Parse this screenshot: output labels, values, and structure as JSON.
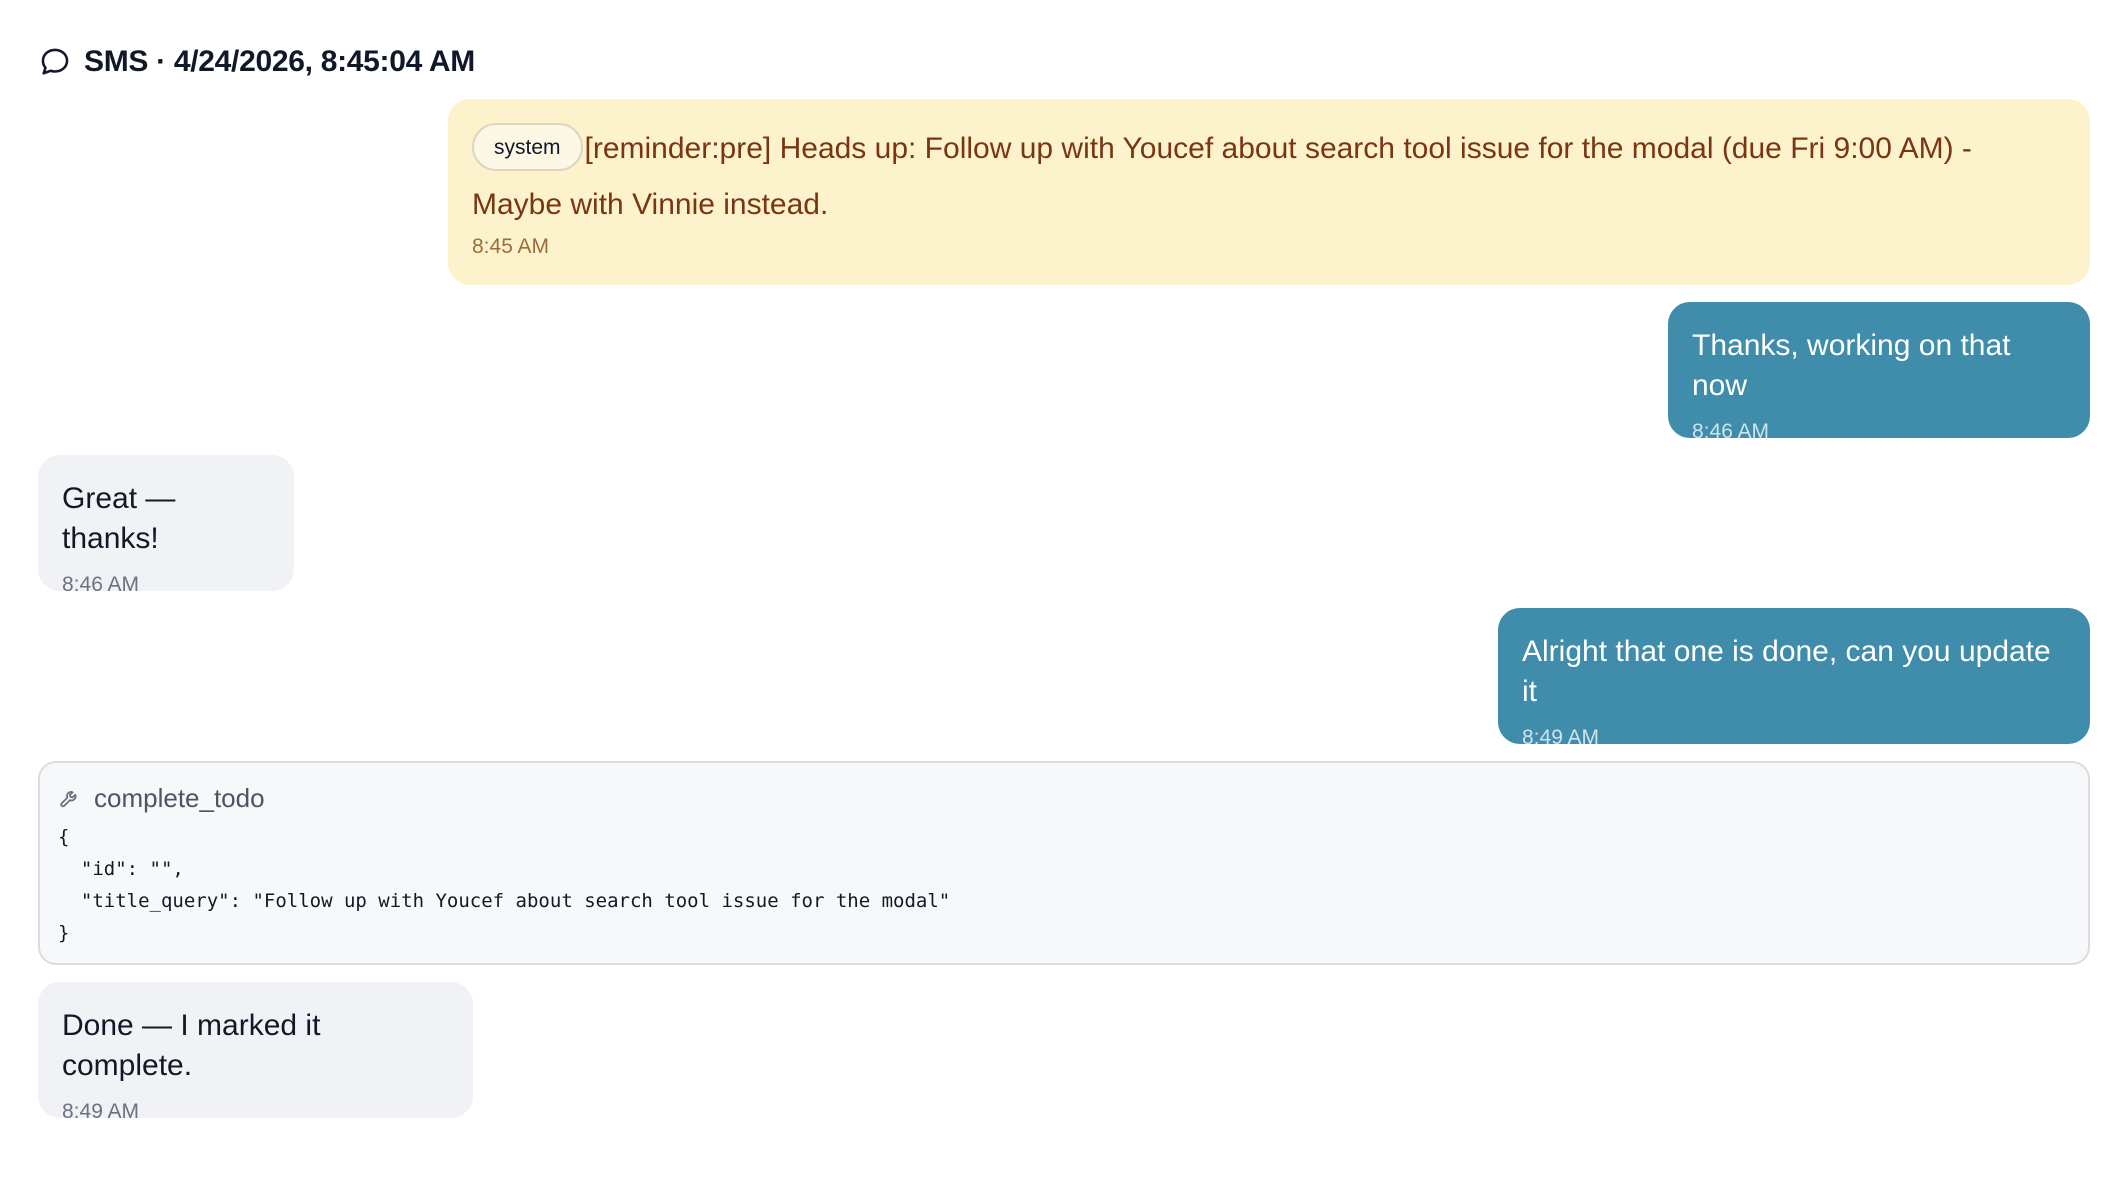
{
  "header": {
    "icon": "chat-bubble-icon",
    "title": "SMS · 4/24/2026, 8:45:04 AM"
  },
  "messages": [
    {
      "role": "system",
      "tag": "system",
      "text": "[reminder:pre] Heads up: Follow up with Youcef about search tool issue for the modal (due Fri 9:00 AM) - Maybe with Vinnie instead.",
      "time": "8:45 AM"
    },
    {
      "role": "user",
      "text": "Thanks, working on that now",
      "time": "8:46 AM"
    },
    {
      "role": "assistant",
      "text": "Great — thanks!",
      "time": "8:46 AM"
    },
    {
      "role": "user",
      "text": "Alright that one is done, can you update it",
      "time": "8:49 AM"
    },
    {
      "role": "tool",
      "icon": "wrench-icon",
      "name": "complete_todo",
      "code": "{\n  \"id\": \"\",\n  \"title_query\": \"Follow up with Youcef about search tool issue for the modal\"\n}"
    },
    {
      "role": "assistant",
      "text": "Done — I marked it complete.",
      "time": "8:49 AM"
    }
  ],
  "colors": {
    "system_bg": "#fcf3cc",
    "system_text": "#7a3512",
    "user_bg": "#3f8cab",
    "assistant_bg": "#f0f2f5",
    "tool_bg": "#f7f8fa"
  }
}
